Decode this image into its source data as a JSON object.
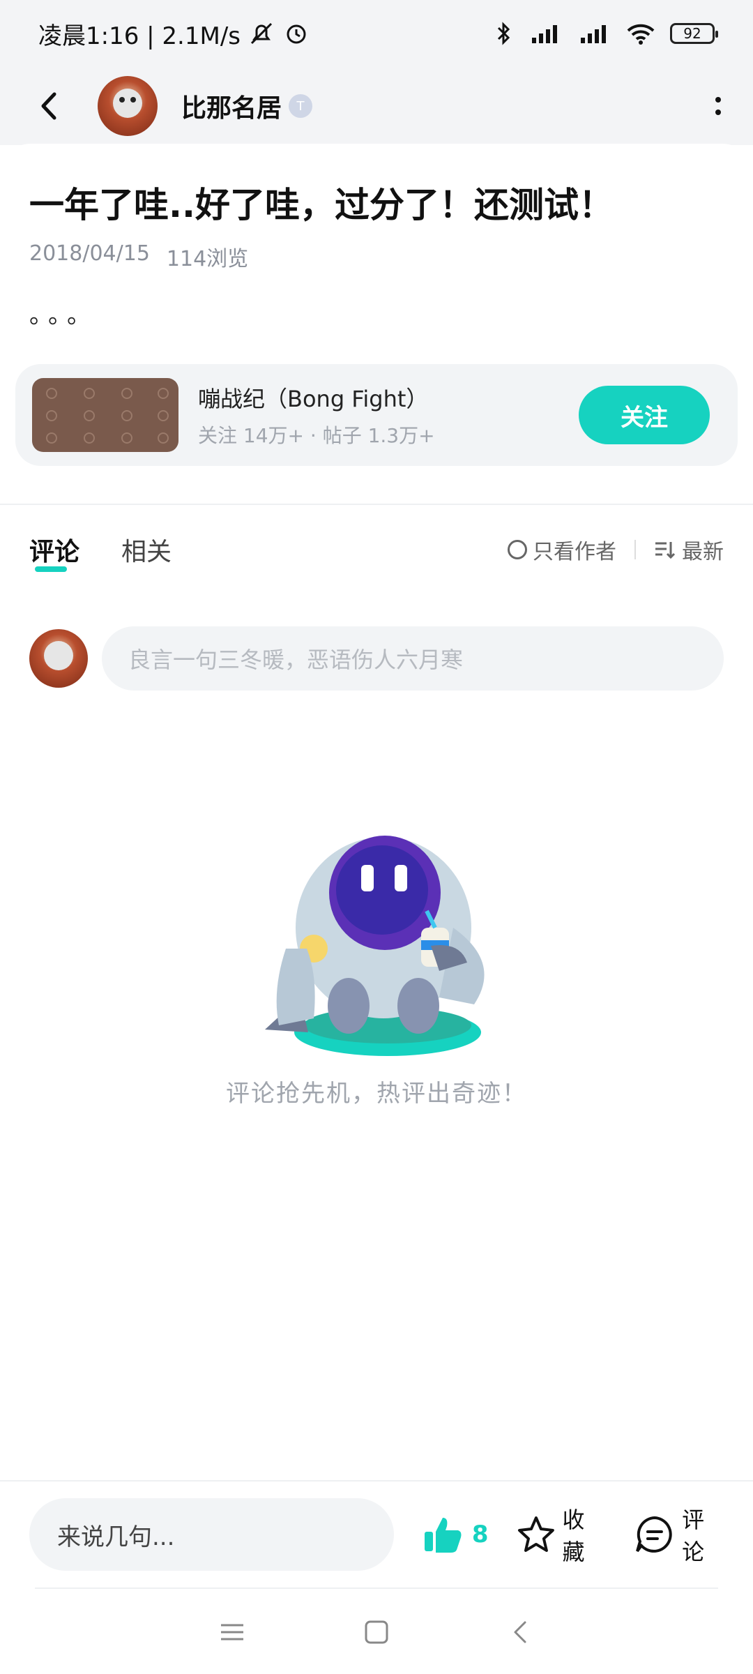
{
  "status_bar": {
    "time_speed": "凌晨1:16 | 2.1M/s",
    "battery": "92"
  },
  "header": {
    "username": "比那名居",
    "badge": "T"
  },
  "post": {
    "title": "一年了哇..好了哇，过分了！还测试！",
    "date": "2018/04/15",
    "views": "114浏览",
    "content": "。。。"
  },
  "game": {
    "name": "嘣战纪（Bong Fight）",
    "stats": "关注 14万+ · 帖子 1.3万+",
    "follow_label": "关注"
  },
  "tabs": {
    "comments": "评论",
    "related": "相关",
    "author_only": "只看作者",
    "sort": "最新"
  },
  "comment_input": {
    "placeholder": "良言一句三冬暖，恶语伤人六月寒"
  },
  "empty_state": {
    "text": "评论抢先机，热评出奇迹！"
  },
  "bottom_bar": {
    "say_placeholder": "来说几句...",
    "like_count": "8",
    "favorite_label": "收藏",
    "comment_label": "评论"
  },
  "colors": {
    "accent": "#16d2c0"
  }
}
